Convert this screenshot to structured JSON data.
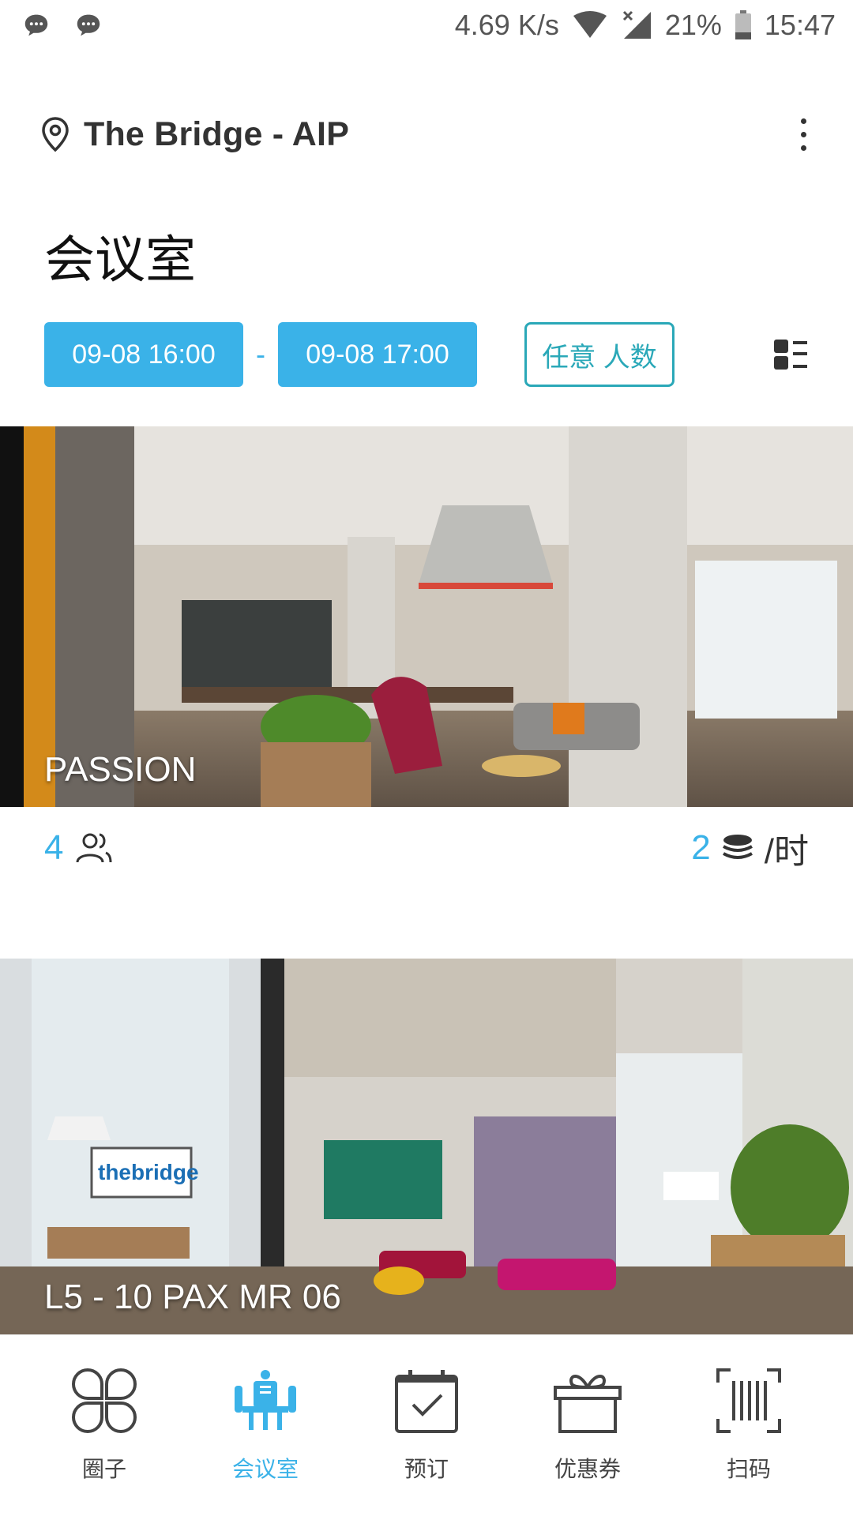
{
  "status_bar": {
    "network_speed": "4.69 K/s",
    "battery": "21%",
    "time": "15:47"
  },
  "header": {
    "location": "The Bridge - AIP"
  },
  "page": {
    "title": "会议室"
  },
  "filters": {
    "start_time": "09-08 16:00",
    "separator": "-",
    "end_time": "09-08 17:00",
    "people": "任意 人数"
  },
  "rooms": [
    {
      "name": "PASSION",
      "capacity": "4",
      "price": "2",
      "price_unit": "/时"
    },
    {
      "name": "L5 - 10 PAX MR 06"
    }
  ],
  "bottom_nav": {
    "items": [
      {
        "label": "圈子",
        "icon": "clover-icon"
      },
      {
        "label": "会议室",
        "icon": "meeting-room-icon"
      },
      {
        "label": "预订",
        "icon": "calendar-check-icon"
      },
      {
        "label": "优惠券",
        "icon": "gift-icon"
      },
      {
        "label": "扫码",
        "icon": "barcode-scan-icon"
      }
    ],
    "active": "会议室"
  },
  "colors": {
    "accent": "#3ab2e8",
    "teal": "#2aa8b8"
  }
}
